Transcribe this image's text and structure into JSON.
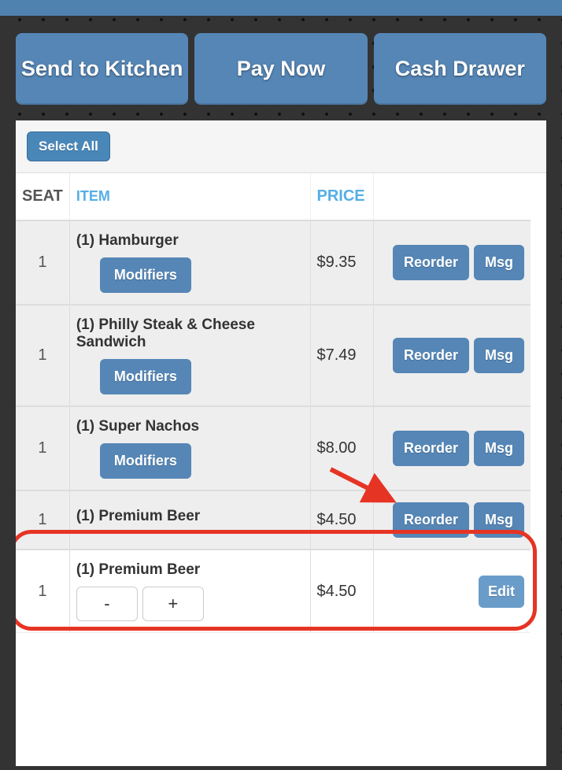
{
  "topActions": {
    "sendKitchen": "Send to Kitchen",
    "payNow": "Pay Now",
    "cashDrawer": "Cash Drawer"
  },
  "panel": {
    "selectAll": "Select All"
  },
  "columns": {
    "seat": "SEAT",
    "item": "ITEM",
    "price": "PRICE"
  },
  "buttons": {
    "modifiers": "Modifiers",
    "reorder": "Reorder",
    "msg": "Msg",
    "edit": "Edit",
    "minus": "-",
    "plus": "+"
  },
  "rows": [
    {
      "seat": "1",
      "name": "(1) Hamburger",
      "price": "$9.35",
      "mod": true,
      "type": "sent"
    },
    {
      "seat": "1",
      "name": "(1) Philly Steak & Cheese Sandwich",
      "price": "$7.49",
      "mod": true,
      "type": "sent"
    },
    {
      "seat": "1",
      "name": "(1) Super Nachos",
      "price": "$8.00",
      "mod": true,
      "type": "sent"
    },
    {
      "seat": "1",
      "name": "(1) Premium Beer",
      "price": "$4.50",
      "mod": false,
      "type": "sent"
    },
    {
      "seat": "1",
      "name": "(1) Premium Beer",
      "price": "$4.50",
      "mod": false,
      "type": "new"
    }
  ]
}
